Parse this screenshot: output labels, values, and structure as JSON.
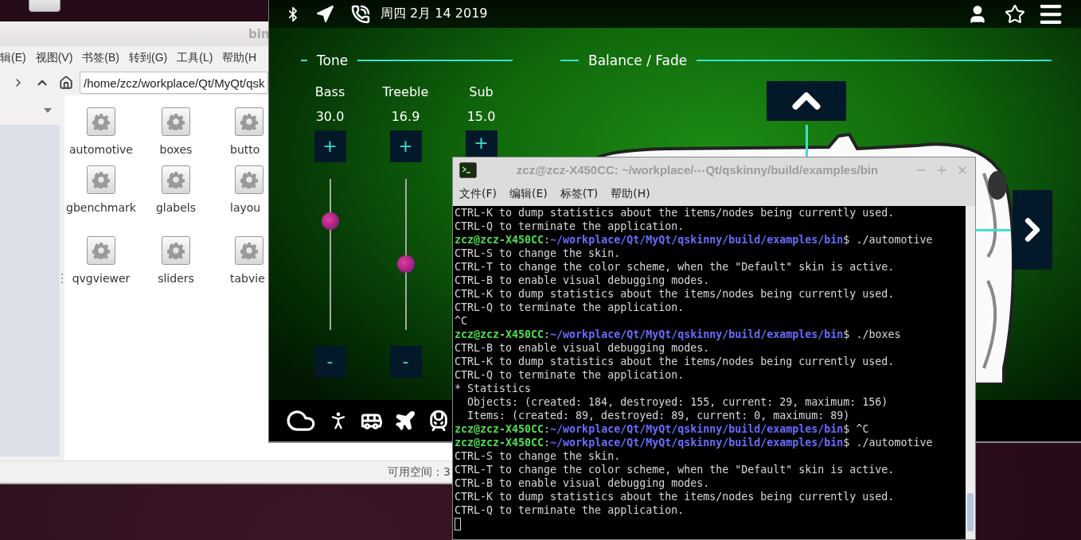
{
  "file_manager": {
    "title": "bin",
    "menu": [
      "辑(E)",
      "视图(V)",
      "书签(B)",
      "转到(G)",
      "工具(L)",
      "帮助(H"
    ],
    "path": "/home/zcz/workplace/Qt/MyQt/qsk",
    "files": [
      {
        "name": "automotive"
      },
      {
        "name": "boxes"
      },
      {
        "name": "butto"
      },
      {
        "name": "gbenchmark"
      },
      {
        "name": "glabels"
      },
      {
        "name": "layou"
      },
      {
        "name": "qvgviewer"
      },
      {
        "name": "sliders"
      },
      {
        "name": "tabvie"
      }
    ],
    "status": "可用空间：3"
  },
  "automotive": {
    "date": "周四 2月 14 2019",
    "tone": {
      "title": "Tone",
      "sliders": [
        {
          "label": "Bass",
          "value": "30.0",
          "plus": "+",
          "minus": "-",
          "level": 0.75
        },
        {
          "label": "Treeble",
          "value": "16.9",
          "plus": "+",
          "minus": "-",
          "level": 0.43
        },
        {
          "label": "Sub",
          "value": "15.0",
          "plus": "+"
        }
      ]
    },
    "balance": {
      "title": "Balance / Fade"
    }
  },
  "terminal": {
    "title": "zcz@zcz-X450CC: ~/workplace/⋯Qt/qskinny/build/examples/bin",
    "menu": [
      "文件(F)",
      "编辑(E)",
      "标签(T)",
      "帮助(H)"
    ],
    "lines": [
      {
        "kind": "output",
        "text": "CTRL-K to dump statistics about the items/nodes being currently used."
      },
      {
        "kind": "output",
        "text": "CTRL-Q to terminate the application."
      },
      {
        "kind": "prompt",
        "user": "zcz@zcz-X450CC",
        "sep": ":",
        "path": "~/workplace/Qt/MyQt/qskinny/build/examples/bin",
        "sign": "$",
        "command": "./automotive"
      },
      {
        "kind": "output",
        "text": "CTRL-S to change the skin."
      },
      {
        "kind": "output",
        "text": "CTRL-T to change the color scheme, when the \"Default\" skin is active."
      },
      {
        "kind": "output",
        "text": "CTRL-B to enable visual debugging modes."
      },
      {
        "kind": "output",
        "text": "CTRL-K to dump statistics about the items/nodes being currently used."
      },
      {
        "kind": "output",
        "text": "CTRL-Q to terminate the application."
      },
      {
        "kind": "output",
        "text": "^C"
      },
      {
        "kind": "prompt",
        "user": "zcz@zcz-X450CC",
        "sep": ":",
        "path": "~/workplace/Qt/MyQt/qskinny/build/examples/bin",
        "sign": "$",
        "command": "./boxes"
      },
      {
        "kind": "output",
        "text": "CTRL-B to enable visual debugging modes."
      },
      {
        "kind": "output",
        "text": "CTRL-K to dump statistics about the items/nodes being currently used."
      },
      {
        "kind": "output",
        "text": "CTRL-Q to terminate the application."
      },
      {
        "kind": "output",
        "text": "* Statistics"
      },
      {
        "kind": "output",
        "text": "  Objects: (created: 184, destroyed: 155, current: 29, maximum: 156)"
      },
      {
        "kind": "output",
        "text": "  Items: (created: 89, destroyed: 89, current: 0, maximum: 89)"
      },
      {
        "kind": "prompt",
        "user": "zcz@zcz-X450CC",
        "sep": ":",
        "path": "~/workplace/Qt/MyQt/qskinny/build/examples/bin",
        "sign": "$",
        "command": "^C"
      },
      {
        "kind": "prompt",
        "user": "zcz@zcz-X450CC",
        "sep": ":",
        "path": "~/workplace/Qt/MyQt/qskinny/build/examples/bin",
        "sign": "$",
        "command": "./automotive"
      },
      {
        "kind": "output",
        "text": "CTRL-S to change the skin."
      },
      {
        "kind": "output",
        "text": "CTRL-T to change the color scheme, when the \"Default\" skin is active."
      },
      {
        "kind": "output",
        "text": "CTRL-B to enable visual debugging modes."
      },
      {
        "kind": "output",
        "text": "CTRL-K to dump statistics about the items/nodes being currently used."
      },
      {
        "kind": "output",
        "text": "CTRL-Q to terminate the application."
      },
      {
        "kind": "cursor"
      }
    ]
  }
}
